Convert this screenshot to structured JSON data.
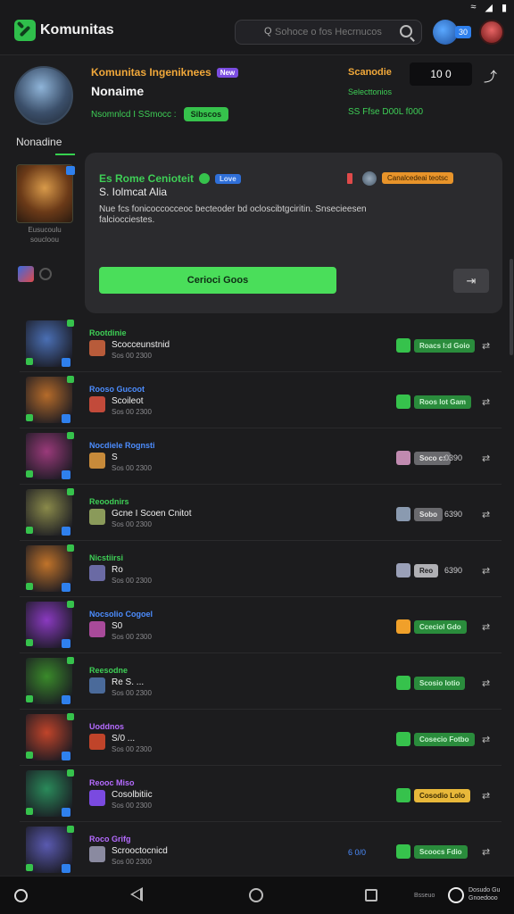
{
  "app": {
    "title": "Komunitas",
    "status_icons": [
      "wifi-icon",
      "signal-icon",
      "battery-icon"
    ]
  },
  "header": {
    "search_lead": "Q",
    "search_placeholder": "Sohoce o fos Hecrnucos",
    "notification_badge": "30"
  },
  "profile": {
    "title": "Komunitas Ingeniknees",
    "tag": "New",
    "subtitle": "Nonaime",
    "meta_text": "Nsomnlcd I SSmocc :",
    "meta_button": "Sibscos",
    "name_label": "Nonadine",
    "stat_label_1": "Scanodie",
    "stat_label_2": "Selecttonios",
    "stat_label_3": "SS Ffse D00L f000",
    "count": "10 0"
  },
  "sidebar": {
    "caption": "Eusucoulu soucloou"
  },
  "feature": {
    "title": "Es Rome Cenioteit",
    "tag": "Love",
    "subtitle": "S. Iolmcat Alia",
    "description": "Nue fcs fonicoccocceoc becteoder bd ocloscibtgciritin. Snsecieesen falciocciestes.",
    "tag2": "Canalcedeai teotsc",
    "primary_button": "Cerioci Goos",
    "secondary_button_icon": "share-icon"
  },
  "list": [
    {
      "title": "Rootdinie",
      "title_color": "#3ecf56",
      "name": "Scocceunstnid",
      "time": "Sos 00 2300",
      "action_label": "Roacs I:d Goio",
      "action_color": "#2a8c3c",
      "action_text_color": "#c8f2cf",
      "action_icon_color": "#36c24c",
      "thumb": "#4a6fb4",
      "mini": "#b85b3a"
    },
    {
      "title": "Rooso Gucoot",
      "title_color": "#4c8dff",
      "name": "Scoileot",
      "time": "Sos 00 2300",
      "action_label": "Roos lot Gam",
      "action_color": "#2a8c3c",
      "action_text_color": "#c8f2cf",
      "action_icon_color": "#36c24c",
      "thumb": "#b56b2a",
      "mini": "#c24a3a"
    },
    {
      "title": "Nocdiele Rognsti",
      "title_color": "#4c8dff",
      "name": "S",
      "time": "Sos 00 2300",
      "action_label": "Soco c:",
      "action_extra": "0390",
      "action_color": "#6a6a6e",
      "action_text_color": "#e8e8e8",
      "action_icon_color": "#c08ab0",
      "thumb": "#9a3a7a",
      "mini": "#c78a3a"
    },
    {
      "title": "Reoodnirs",
      "title_color": "#3ecf56",
      "name": "Gcne I Scoen Cnitot",
      "time": "Sos 00 2300",
      "action_label": "Sobo",
      "action_extra": "6390",
      "action_color": "#6a6a6e",
      "action_text_color": "#e8e8e8",
      "action_icon_color": "#8a9ab0",
      "thumb": "#8a8a4a",
      "mini": "#8a9a5a"
    },
    {
      "title": "Nicstiirsi",
      "title_color": "#3ecf56",
      "name": "Ro",
      "time": "Sos 00 2300",
      "action_label": "Reo",
      "action_extra": "6390",
      "action_color": "#b0b0b4",
      "action_text_color": "#1c1c1e",
      "action_icon_color": "#9aa0b8",
      "thumb": "#c0732a",
      "mini": "#6a6aa4"
    },
    {
      "title": "Nocsolio Cogoel",
      "title_color": "#4c8dff",
      "name": "S0",
      "time": "Sos 00 2300",
      "action_label": "Cceciol Gdo",
      "action_color": "#2a8c3c",
      "action_text_color": "#c8f2cf",
      "action_icon_color": "#f0a02a",
      "thumb": "#8a3ac0",
      "mini": "#a84a9a"
    },
    {
      "title": "Reesodne",
      "title_color": "#3ecf56",
      "name": "Re S. ...",
      "time": "Sos 00 2300",
      "action_label": "Scosio Iotio",
      "action_color": "#2a8c3c",
      "action_text_color": "#c8f2cf",
      "action_icon_color": "#36c24c",
      "thumb": "#3a8a2a",
      "mini": "#4a6a9a"
    },
    {
      "title": "Uoddnos",
      "title_color": "#b56bff",
      "name": "S/0 ...",
      "time": "Sos 00 2300",
      "action_label": "Cosecio Fotbo",
      "action_color": "#2a8c3c",
      "action_text_color": "#c8f2cf",
      "action_icon_color": "#36c24c",
      "thumb": "#c0442a",
      "mini": "#c0442a"
    },
    {
      "title": "Reooc Miso",
      "title_color": "#b56bff",
      "name": "Cosolbitiic",
      "time": "Sos 00 2300",
      "action_label": "Cosodio Lolo",
      "action_color": "#e8b83a",
      "action_text_color": "#3a2a00",
      "action_icon_color": "#36c24c",
      "thumb": "#2a8a5a",
      "mini": "#7a4ae0"
    },
    {
      "title": "Roco Grifg",
      "title_color": "#b56bff",
      "name": "Scrooctocnicd",
      "time": "Sos 00 2300",
      "annotation": "6 0/0",
      "action_label": "Scoocs Fdio",
      "action_color": "#2a8c3c",
      "action_text_color": "#c8f2cf",
      "action_icon_color": "#36c24c",
      "thumb": "#5a5ab0",
      "mini": "#8a8aa0"
    }
  ],
  "bottom_nav": {
    "small_label": "Bsseuo",
    "brand_text": "Dosudo Gu Gnoedooo"
  }
}
